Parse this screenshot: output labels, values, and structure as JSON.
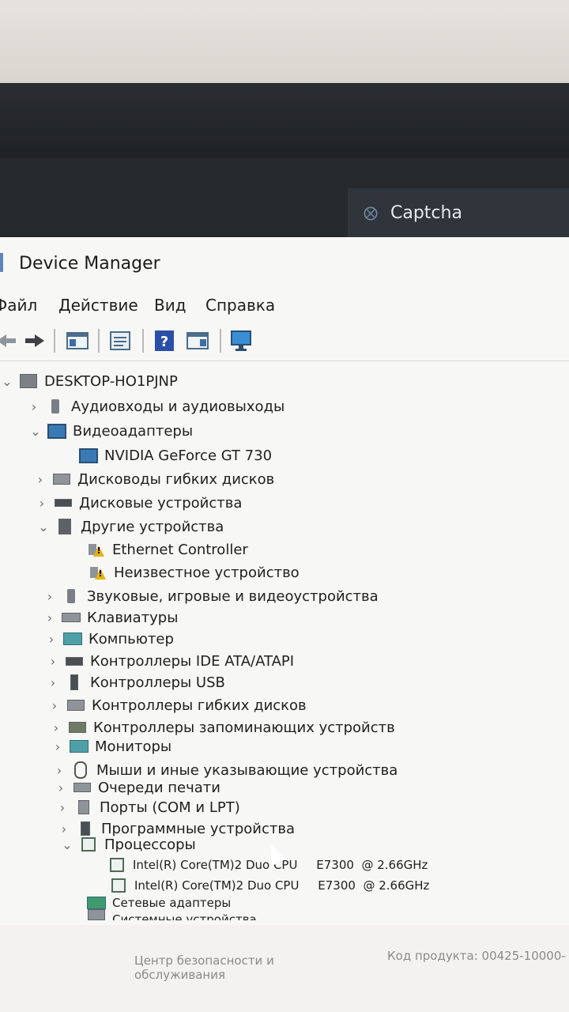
{
  "captcha_tab": {
    "title": "Captcha",
    "icon": "captcha-icon"
  },
  "window": {
    "title": "Device Manager"
  },
  "menu": {
    "items": [
      "Файл",
      "Действие",
      "Вид",
      "Справка"
    ]
  },
  "toolbar": {
    "buttons": [
      "back-icon",
      "forward-icon",
      "show-hide-tree-icon",
      "properties-icon",
      "help-icon",
      "action-pane-icon",
      "scan-hardware-icon"
    ]
  },
  "tree": {
    "root": "DESKTOP-HO1PJNP",
    "items": [
      {
        "label": "Аудиовходы и аудиовыходы",
        "expanded": false,
        "icon": "speaker-icon"
      },
      {
        "label": "Видеоадаптеры",
        "expanded": true,
        "icon": "display-adapter-icon"
      },
      {
        "label": "NVIDIA GeForce GT 730",
        "child": true,
        "icon": "display-adapter-icon"
      },
      {
        "label": "Дисководы гибких дисков",
        "expanded": false,
        "icon": "floppy-drive-icon"
      },
      {
        "label": "Дисковые устройства",
        "expanded": false,
        "icon": "disk-drive-icon"
      },
      {
        "label": "Другие устройства",
        "expanded": true,
        "icon": "other-devices-icon"
      },
      {
        "label": "Ethernet Controller",
        "child": true,
        "icon": "warning-device-icon"
      },
      {
        "label": "Неизвестное устройство",
        "child": true,
        "icon": "warning-device-icon"
      },
      {
        "label": "Звуковые, игровые и видеоустройства",
        "expanded": false,
        "icon": "sound-icon"
      },
      {
        "label": "Клавиатуры",
        "expanded": false,
        "icon": "keyboard-icon"
      },
      {
        "label": "Компьютер",
        "expanded": false,
        "icon": "computer-icon"
      },
      {
        "label": "Контроллеры IDE ATA/ATAPI",
        "expanded": false,
        "icon": "ide-controller-icon"
      },
      {
        "label": "Контроллеры USB",
        "expanded": false,
        "icon": "usb-icon"
      },
      {
        "label": "Контроллеры гибких дисков",
        "expanded": false,
        "icon": "floppy-controller-icon"
      },
      {
        "label": "Контроллеры запоминающих устройств",
        "expanded": false,
        "icon": "storage-controller-icon"
      },
      {
        "label": "Мониторы",
        "expanded": false,
        "icon": "monitor-icon"
      },
      {
        "label": "Мыши и иные указывающие устройства",
        "expanded": false,
        "icon": "mouse-icon"
      },
      {
        "label": "Очереди печати",
        "expanded": false,
        "icon": "printer-icon"
      },
      {
        "label": "Порты (COM и LPT)",
        "expanded": false,
        "icon": "port-icon"
      },
      {
        "label": "Программные устройства",
        "expanded": false,
        "icon": "software-device-icon"
      },
      {
        "label": "Процессоры",
        "expanded": true,
        "icon": "processor-icon"
      },
      {
        "label": "Intel(R) Core(TM)2 Duo CPU     E7300  @ 2.66GHz",
        "child": true,
        "icon": "processor-icon"
      },
      {
        "label": "Intel(R) Core(TM)2 Duo CPU     E7300  @ 2.66GHz",
        "child": true,
        "icon": "processor-icon"
      },
      {
        "label": "Сетевые адаптеры",
        "expanded": false,
        "icon": "network-adapter-icon"
      },
      {
        "label": "Системные устройства",
        "expanded": false,
        "icon": "system-device-icon"
      }
    ]
  },
  "background_text": {
    "left_line1": "Центр безопасности и",
    "left_line2": "обслуживания",
    "right": "Код продукта: 00425-10000-"
  }
}
